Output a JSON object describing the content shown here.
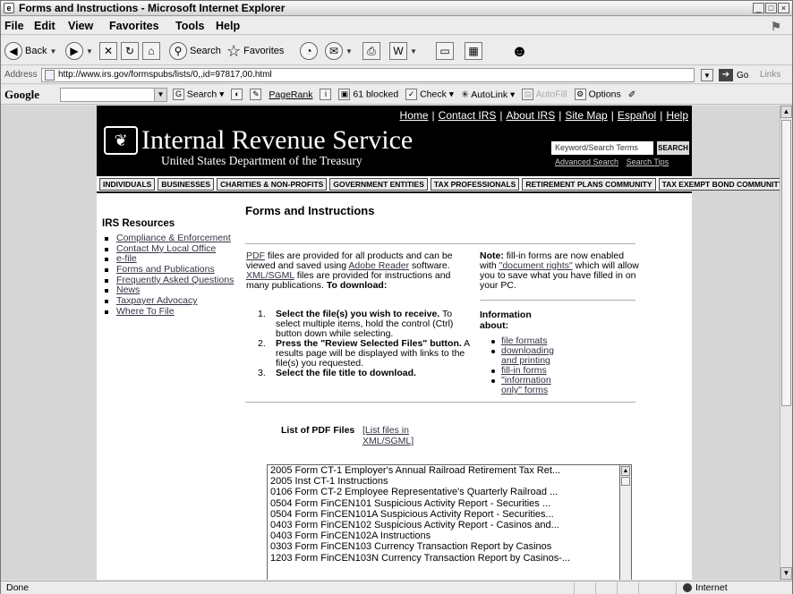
{
  "window": {
    "title": "Forms and Instructions - Microsoft Internet Explorer"
  },
  "menu": [
    "File",
    "Edit",
    "View",
    "Favorites",
    "Tools",
    "Help"
  ],
  "toolbar": {
    "back": "Back",
    "search": "Search",
    "favorites": "Favorites"
  },
  "address": {
    "label": "Address",
    "url": "http://www.irs.gov/formspubs/lists/0,,id=97817,00.html",
    "go": "Go",
    "links": "Links"
  },
  "google": {
    "logo": "Google",
    "search": "Search",
    "pagerank": "PageRank",
    "blocked": "61 blocked",
    "check": "Check",
    "autolink": "AutoLink",
    "autofill": "AutoFill",
    "options": "Options"
  },
  "irs": {
    "toplinks": [
      "Home",
      "Contact IRS",
      "About IRS",
      "Site Map",
      "Español",
      "Help"
    ],
    "name": "Internal Revenue Service",
    "subtitle": "United States Department of the Treasury",
    "search_placeholder": "Keyword/Search Terms",
    "search_button": "SEARCH",
    "advanced_search": "Advanced Search",
    "search_tips": "Search Tips",
    "nav": [
      "INDIVIDUALS",
      "BUSINESSES",
      "CHARITIES & NON-PROFITS",
      "GOVERNMENT ENTITIES",
      "TAX PROFESSIONALS",
      "RETIREMENT PLANS COMMUNITY",
      "TAX EXEMPT BOND COMMUNITY"
    ]
  },
  "sidebar": {
    "heading": "IRS Resources",
    "items": [
      "Compliance & Enforcement",
      "Contact My Local Office",
      "e-file",
      "Forms and Publications",
      "Frequently Asked Questions",
      "News",
      "Taxpayer Advocacy",
      "Where To File"
    ]
  },
  "main": {
    "title": "Forms and Instructions",
    "intro": {
      "pdf": "PDF",
      "t1": " files are provided for all products and can be viewed and saved using ",
      "reader": "Adobe Reader",
      "t2": " software. ",
      "xml": "XML/SGML",
      "t3": " files are provided for instructions and many publications. ",
      "t4": "To download:"
    },
    "note": {
      "label": "Note:",
      "t1": " fill-in forms are now enabled with ",
      "link": "\"document rights\"",
      "t2": " which will allow you to save what you have filled in on your PC."
    },
    "steps": [
      {
        "n": "1.",
        "bold": "Select the file(s) you wish to receive.",
        "rest": " To select multiple items, hold the control (Ctrl) button down while selecting."
      },
      {
        "n": "2.",
        "bold": "Press the \"Review Selected Files\" button.",
        "rest": " A results page will be displayed with links to the file(s) you requested."
      },
      {
        "n": "3.",
        "bold": "Select the file title to download.",
        "rest": ""
      }
    ],
    "info_heading": "Information about:",
    "info_items": [
      "file formats",
      "downloading and printing",
      "fill-in forms",
      "\"information only\" forms"
    ],
    "list_heading": "List of PDF Files",
    "list_xml_link": "[List files in XML/SGML]",
    "files": [
      "2005 Form CT-1 Employer's Annual Railroad Retirement Tax Ret...",
      "2005 Inst CT-1 Instructions",
      "0106 Form CT-2 Employee Representative's Quarterly Railroad ...",
      "0504 Form FinCEN101 Suspicious Activity Report - Securities ...",
      "0504 Form FinCEN101A Suspicious Activity Report - Securities...",
      "0403 Form FinCEN102 Suspicious Activity Report - Casinos and...",
      "0403 Form FinCEN102A Instructions",
      "0303 Form FinCEN103 Currency Transaction Report by Casinos",
      "1203 Form FinCEN103N Currency Transaction Report by Casinos-..."
    ]
  },
  "status": {
    "text": "Done",
    "zone": "Internet"
  }
}
